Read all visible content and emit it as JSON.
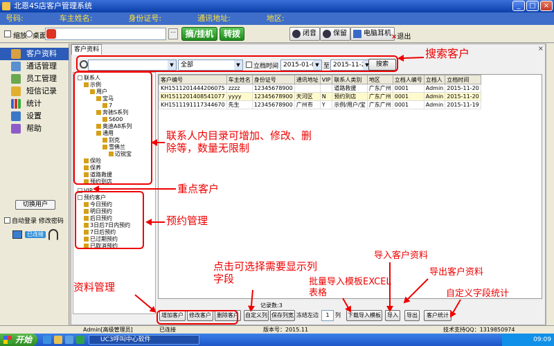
{
  "window": {
    "title": "北恩4S店客户管理系统",
    "controls": [
      "_",
      "□",
      "×"
    ]
  },
  "infobar": {
    "phone_label": "号码:",
    "name_label": "车主姓名:",
    "id_label": "身份证号:",
    "address_label": "通讯地址:",
    "region_label": "地区:"
  },
  "toolbar": {
    "minimize_label": "缩放",
    "desktop_label": "桌面",
    "hangup_label": "摘/挂机",
    "transfer_label": "转拨",
    "mute_label": "闭音",
    "hold_label": "保留",
    "pc_headset_label": "电脑耳机",
    "exit_label": "退出"
  },
  "sidebar": {
    "items": [
      {
        "label": "客户资料",
        "icon": "customer-icon",
        "active": true
      },
      {
        "label": "通话管理",
        "icon": "call-icon"
      },
      {
        "label": "员工管理",
        "icon": "staff-icon"
      },
      {
        "label": "短信记录",
        "icon": "sms-icon"
      },
      {
        "label": "统计",
        "icon": "chart-icon"
      },
      {
        "label": "设置",
        "icon": "settings-icon"
      },
      {
        "label": "帮助",
        "icon": "help-icon"
      }
    ],
    "switch_user": "切换用户",
    "auto_login": "自动登录",
    "change_password": "修改密码",
    "status": "已连接"
  },
  "tab": {
    "label": "客户资料"
  },
  "search": {
    "dropdown1": "",
    "dropdown2": "全部",
    "date_check_label": "立档时间",
    "date_from": "2015-01-01",
    "to_label": "至",
    "date_to": "2015-11-23",
    "button": "搜索"
  },
  "tree": [
    {
      "label": "联系人",
      "indent": 0
    },
    {
      "label": "示例",
      "indent": 1
    },
    {
      "label": "用户",
      "indent": 2
    },
    {
      "label": "宝马",
      "indent": 3
    },
    {
      "label": "7",
      "indent": 4
    },
    {
      "label": "奔驰S系列",
      "indent": 3
    },
    {
      "label": "S600",
      "indent": 4
    },
    {
      "label": "奥迪A8系列",
      "indent": 3
    },
    {
      "label": "通用",
      "indent": 3
    },
    {
      "label": "别克",
      "indent": 4
    },
    {
      "label": "雪佛兰",
      "indent": 4
    },
    {
      "label": "迈锐宝",
      "indent": 5
    },
    {
      "label": "保险",
      "indent": 1
    },
    {
      "label": "保养",
      "indent": 1
    },
    {
      "label": "道路救援",
      "indent": 1
    },
    {
      "label": "预约到店",
      "indent": 1
    },
    {
      "label": "VIP",
      "indent": 0
    },
    {
      "label": "预约客户",
      "indent": 0
    },
    {
      "label": "今日预约",
      "indent": 1
    },
    {
      "label": "明日预约",
      "indent": 1
    },
    {
      "label": "后日预约",
      "indent": 1
    },
    {
      "label": "3日后7日内预约",
      "indent": 1
    },
    {
      "label": "7日后预约",
      "indent": 1
    },
    {
      "label": "已过期预约",
      "indent": 1
    },
    {
      "label": "已取消预约",
      "indent": 1
    }
  ],
  "table": {
    "columns": [
      "客户编号",
      "车主姓名",
      "身份证号",
      "通讯地址",
      "VIP",
      "联系人类别",
      "地区",
      "立档人编号",
      "立档人",
      "立档时间"
    ],
    "rows": [
      [
        "KH1511201444206075",
        "zzzz",
        "12345678900",
        "",
        "",
        "道路救援",
        "广东广州",
        "0001",
        "Admin",
        "2015-11-20"
      ],
      [
        "KH1511201408541077",
        "yyyy",
        "12345678900",
        "天河区",
        "N",
        "预约到店",
        "广东广州",
        "0001",
        "Admin",
        "2015-11-20"
      ],
      [
        "KH1511191117344670",
        "先生",
        "12345678900",
        "广州市",
        "Y",
        "示例/用户/宝",
        "广东广州",
        "0001",
        "Admin",
        "2015-11-19"
      ]
    ]
  },
  "record_count": "记录数:3",
  "bottom": {
    "add": "增加客户",
    "edit": "修改客户",
    "delete": "删除客户",
    "custom_cols": "自定义列",
    "save_cols": "保存列宽",
    "freeze_label": "冻结左边",
    "freeze_value": "1",
    "col_label": "列",
    "download_tpl": "下载导入模板",
    "import": "导入",
    "export": "导出",
    "stats": "客户统计"
  },
  "statusbar": {
    "user": "Admin[高级管理员]",
    "conn": "已连接",
    "version": "版本号：2015.11",
    "support": "技术支持QQ：1319850974"
  },
  "taskbar": {
    "start": "开始",
    "app": "UC3呼叫中心软件",
    "clock": "09:09"
  },
  "annotations": {
    "search": "搜索客户",
    "tree": "联系人内目录可增加、修改、删除等，数量无限制",
    "vip": "重点客户",
    "appoint": "预约管理",
    "cols": "点击可选择需要显示列字段",
    "batch": "批量导入模板EXCEL表格",
    "import": "导入客户资料",
    "export": "导出客户资料",
    "stats": "自定义字段统计",
    "data": "资料管理"
  },
  "colors": {
    "annotation": "#e00000",
    "title_bar": "#0a3ea8",
    "active_nav": "#2c5bb8"
  }
}
